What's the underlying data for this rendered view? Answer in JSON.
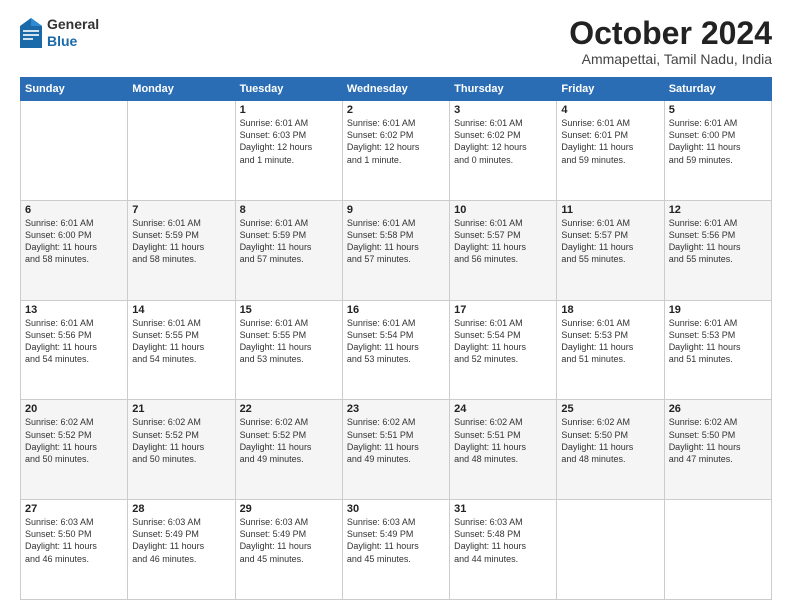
{
  "logo": {
    "general": "General",
    "blue": "Blue"
  },
  "header": {
    "title": "October 2024",
    "subtitle": "Ammapettai, Tamil Nadu, India"
  },
  "days_of_week": [
    "Sunday",
    "Monday",
    "Tuesday",
    "Wednesday",
    "Thursday",
    "Friday",
    "Saturday"
  ],
  "weeks": [
    [
      {
        "day": "",
        "info": ""
      },
      {
        "day": "",
        "info": ""
      },
      {
        "day": "1",
        "info": "Sunrise: 6:01 AM\nSunset: 6:03 PM\nDaylight: 12 hours\nand 1 minute."
      },
      {
        "day": "2",
        "info": "Sunrise: 6:01 AM\nSunset: 6:02 PM\nDaylight: 12 hours\nand 1 minute."
      },
      {
        "day": "3",
        "info": "Sunrise: 6:01 AM\nSunset: 6:02 PM\nDaylight: 12 hours\nand 0 minutes."
      },
      {
        "day": "4",
        "info": "Sunrise: 6:01 AM\nSunset: 6:01 PM\nDaylight: 11 hours\nand 59 minutes."
      },
      {
        "day": "5",
        "info": "Sunrise: 6:01 AM\nSunset: 6:00 PM\nDaylight: 11 hours\nand 59 minutes."
      }
    ],
    [
      {
        "day": "6",
        "info": "Sunrise: 6:01 AM\nSunset: 6:00 PM\nDaylight: 11 hours\nand 58 minutes."
      },
      {
        "day": "7",
        "info": "Sunrise: 6:01 AM\nSunset: 5:59 PM\nDaylight: 11 hours\nand 58 minutes."
      },
      {
        "day": "8",
        "info": "Sunrise: 6:01 AM\nSunset: 5:59 PM\nDaylight: 11 hours\nand 57 minutes."
      },
      {
        "day": "9",
        "info": "Sunrise: 6:01 AM\nSunset: 5:58 PM\nDaylight: 11 hours\nand 57 minutes."
      },
      {
        "day": "10",
        "info": "Sunrise: 6:01 AM\nSunset: 5:57 PM\nDaylight: 11 hours\nand 56 minutes."
      },
      {
        "day": "11",
        "info": "Sunrise: 6:01 AM\nSunset: 5:57 PM\nDaylight: 11 hours\nand 55 minutes."
      },
      {
        "day": "12",
        "info": "Sunrise: 6:01 AM\nSunset: 5:56 PM\nDaylight: 11 hours\nand 55 minutes."
      }
    ],
    [
      {
        "day": "13",
        "info": "Sunrise: 6:01 AM\nSunset: 5:56 PM\nDaylight: 11 hours\nand 54 minutes."
      },
      {
        "day": "14",
        "info": "Sunrise: 6:01 AM\nSunset: 5:55 PM\nDaylight: 11 hours\nand 54 minutes."
      },
      {
        "day": "15",
        "info": "Sunrise: 6:01 AM\nSunset: 5:55 PM\nDaylight: 11 hours\nand 53 minutes."
      },
      {
        "day": "16",
        "info": "Sunrise: 6:01 AM\nSunset: 5:54 PM\nDaylight: 11 hours\nand 53 minutes."
      },
      {
        "day": "17",
        "info": "Sunrise: 6:01 AM\nSunset: 5:54 PM\nDaylight: 11 hours\nand 52 minutes."
      },
      {
        "day": "18",
        "info": "Sunrise: 6:01 AM\nSunset: 5:53 PM\nDaylight: 11 hours\nand 51 minutes."
      },
      {
        "day": "19",
        "info": "Sunrise: 6:01 AM\nSunset: 5:53 PM\nDaylight: 11 hours\nand 51 minutes."
      }
    ],
    [
      {
        "day": "20",
        "info": "Sunrise: 6:02 AM\nSunset: 5:52 PM\nDaylight: 11 hours\nand 50 minutes."
      },
      {
        "day": "21",
        "info": "Sunrise: 6:02 AM\nSunset: 5:52 PM\nDaylight: 11 hours\nand 50 minutes."
      },
      {
        "day": "22",
        "info": "Sunrise: 6:02 AM\nSunset: 5:52 PM\nDaylight: 11 hours\nand 49 minutes."
      },
      {
        "day": "23",
        "info": "Sunrise: 6:02 AM\nSunset: 5:51 PM\nDaylight: 11 hours\nand 49 minutes."
      },
      {
        "day": "24",
        "info": "Sunrise: 6:02 AM\nSunset: 5:51 PM\nDaylight: 11 hours\nand 48 minutes."
      },
      {
        "day": "25",
        "info": "Sunrise: 6:02 AM\nSunset: 5:50 PM\nDaylight: 11 hours\nand 48 minutes."
      },
      {
        "day": "26",
        "info": "Sunrise: 6:02 AM\nSunset: 5:50 PM\nDaylight: 11 hours\nand 47 minutes."
      }
    ],
    [
      {
        "day": "27",
        "info": "Sunrise: 6:03 AM\nSunset: 5:50 PM\nDaylight: 11 hours\nand 46 minutes."
      },
      {
        "day": "28",
        "info": "Sunrise: 6:03 AM\nSunset: 5:49 PM\nDaylight: 11 hours\nand 46 minutes."
      },
      {
        "day": "29",
        "info": "Sunrise: 6:03 AM\nSunset: 5:49 PM\nDaylight: 11 hours\nand 45 minutes."
      },
      {
        "day": "30",
        "info": "Sunrise: 6:03 AM\nSunset: 5:49 PM\nDaylight: 11 hours\nand 45 minutes."
      },
      {
        "day": "31",
        "info": "Sunrise: 6:03 AM\nSunset: 5:48 PM\nDaylight: 11 hours\nand 44 minutes."
      },
      {
        "day": "",
        "info": ""
      },
      {
        "day": "",
        "info": ""
      }
    ]
  ]
}
